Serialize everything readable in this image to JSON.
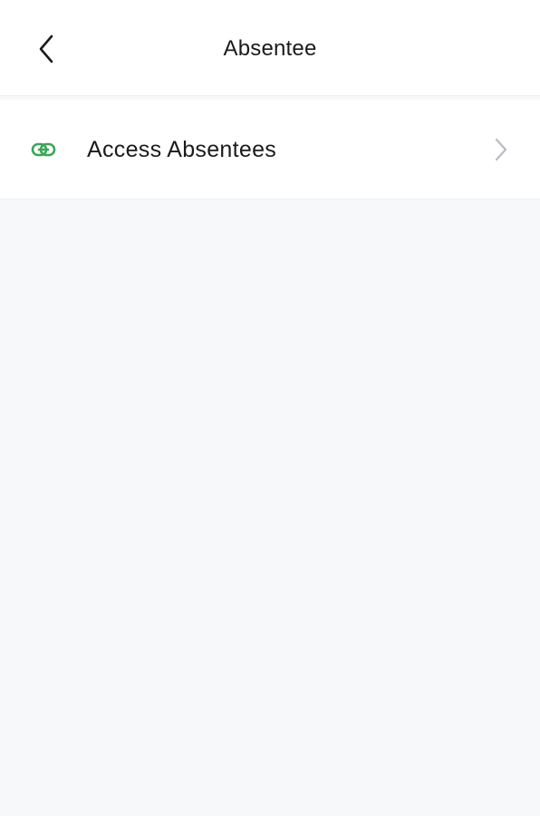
{
  "header": {
    "title": "Absentee",
    "back_icon": "chevron-left-icon"
  },
  "menu": {
    "items": [
      {
        "label": "Access Absentees",
        "icon": "link-icon",
        "icon_color": "#3aa757",
        "trailing_icon": "chevron-right-icon"
      }
    ]
  },
  "colors": {
    "background": "#f7f8fa",
    "surface": "#ffffff",
    "text": "#1b1b1b",
    "accent": "#3aa757",
    "muted_icon": "#b9bcc2"
  }
}
